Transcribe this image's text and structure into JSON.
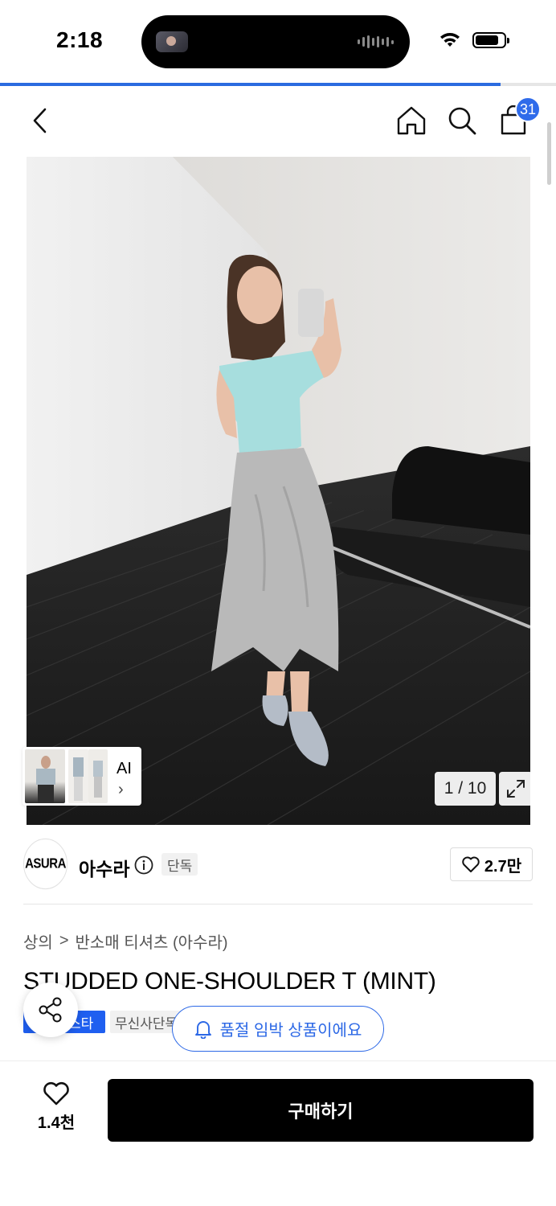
{
  "status_bar": {
    "time": "2:18"
  },
  "page_progress": 0.9,
  "header": {
    "cart_count": "31"
  },
  "gallery": {
    "ai_label": "AI",
    "ai_chevron": "›",
    "counter": "1 / 10"
  },
  "brand": {
    "logo_text": "ASURA",
    "name": "아수라",
    "exclusive_tag": "단독",
    "like_count": "2.7만"
  },
  "breadcrumb": {
    "category": "상의",
    "separator": ">",
    "subcategory": "반소매 티셔츠 (아수라)"
  },
  "product": {
    "title": "STUDDED ONE-SHOULDER T (MINT)"
  },
  "tags": {
    "blue_tag": "스타",
    "gray_tag": "무신사단독"
  },
  "notice": {
    "soldout_text": "품절 임박 상품이에요"
  },
  "bottom_bar": {
    "wish_count": "1.4천",
    "buy_label": "구매하기"
  },
  "colors": {
    "accent_blue": "#2f6bea",
    "tag_blue": "#1f5ff0",
    "buy_button": "#000000"
  },
  "icons": [
    "back-icon",
    "home-icon",
    "search-icon",
    "cart-icon",
    "expand-icon",
    "info-icon",
    "heart-icon",
    "share-icon",
    "bell-icon",
    "wifi-icon",
    "battery-icon"
  ]
}
